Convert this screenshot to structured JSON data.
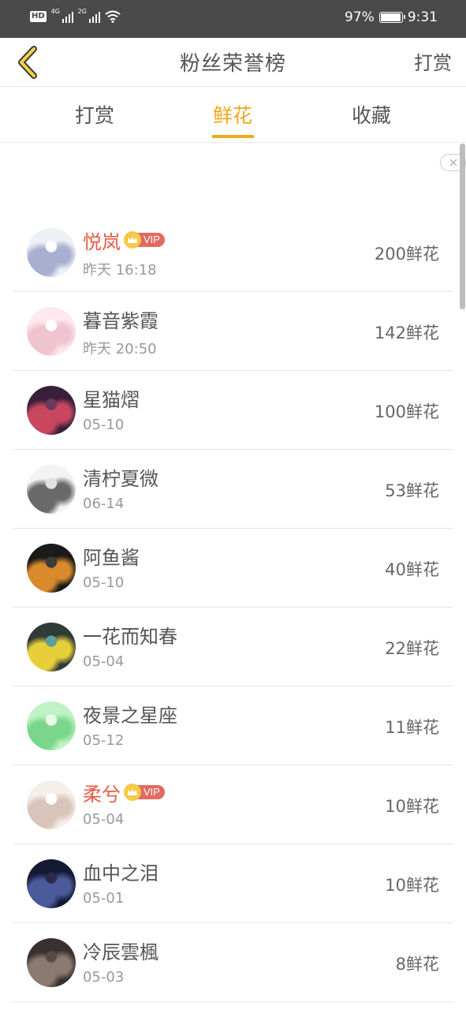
{
  "status_bar": {
    "hd": "HD",
    "net1": "4G",
    "net2": "2G",
    "battery_percent": "97%",
    "battery_level": 0.97,
    "time": "9:31"
  },
  "header": {
    "title": "粉丝荣誉榜",
    "action_label": "打赏"
  },
  "tabs": [
    {
      "label": "打赏",
      "active": false
    },
    {
      "label": "鲜花",
      "active": true
    },
    {
      "label": "收藏",
      "active": false
    }
  ],
  "vip_label": "VIP",
  "colors": {
    "accent": "#f0a81a",
    "vip_name": "#e85a45",
    "vip_badge": "#e26a5f"
  },
  "fans": [
    {
      "name": "悦岚",
      "vip": true,
      "date": "昨天 16:18",
      "count": "200鲜花",
      "avatar_colors": [
        "#eef0f8",
        "#a9afd0",
        "#ffffff"
      ]
    },
    {
      "name": "暮音紫霞",
      "vip": false,
      "date": "昨天 20:50",
      "count": "142鲜花",
      "avatar_colors": [
        "#fbe9ee",
        "#efc3cf",
        "#ffffff"
      ]
    },
    {
      "name": "星猫熠",
      "vip": false,
      "date": "05-10",
      "count": "100鲜花",
      "avatar_colors": [
        "#3a1f3a",
        "#c9475e",
        "#6b3a5e"
      ]
    },
    {
      "name": "清柠夏微",
      "vip": false,
      "date": "06-14",
      "count": "53鲜花",
      "avatar_colors": [
        "#f3f3f3",
        "#6a6a6a",
        "#e2e2e2"
      ]
    },
    {
      "name": "阿鱼酱",
      "vip": false,
      "date": "05-10",
      "count": "40鲜花",
      "avatar_colors": [
        "#1a1a1a",
        "#d98a2b",
        "#3b3b3b"
      ]
    },
    {
      "name": "一花而知春",
      "vip": false,
      "date": "05-04",
      "count": "22鲜花",
      "avatar_colors": [
        "#2f3b36",
        "#e7cf3a",
        "#5aa0a0"
      ]
    },
    {
      "name": "夜景之星座",
      "vip": false,
      "date": "05-12",
      "count": "11鲜花",
      "avatar_colors": [
        "#bff2c4",
        "#7ad68a",
        "#e9fbe9"
      ]
    },
    {
      "name": "柔兮",
      "vip": true,
      "date": "05-04",
      "count": "10鲜花",
      "avatar_colors": [
        "#f6efe9",
        "#d8c4bb",
        "#ffffff"
      ]
    },
    {
      "name": "血中之泪",
      "vip": false,
      "date": "05-01",
      "count": "10鲜花",
      "avatar_colors": [
        "#141a33",
        "#4a5a9a",
        "#2a2a4a"
      ]
    },
    {
      "name": "冷辰雲楓",
      "vip": false,
      "date": "05-03",
      "count": "8鲜花",
      "avatar_colors": [
        "#3a3030",
        "#8a7a70",
        "#5a4a44"
      ]
    }
  ]
}
